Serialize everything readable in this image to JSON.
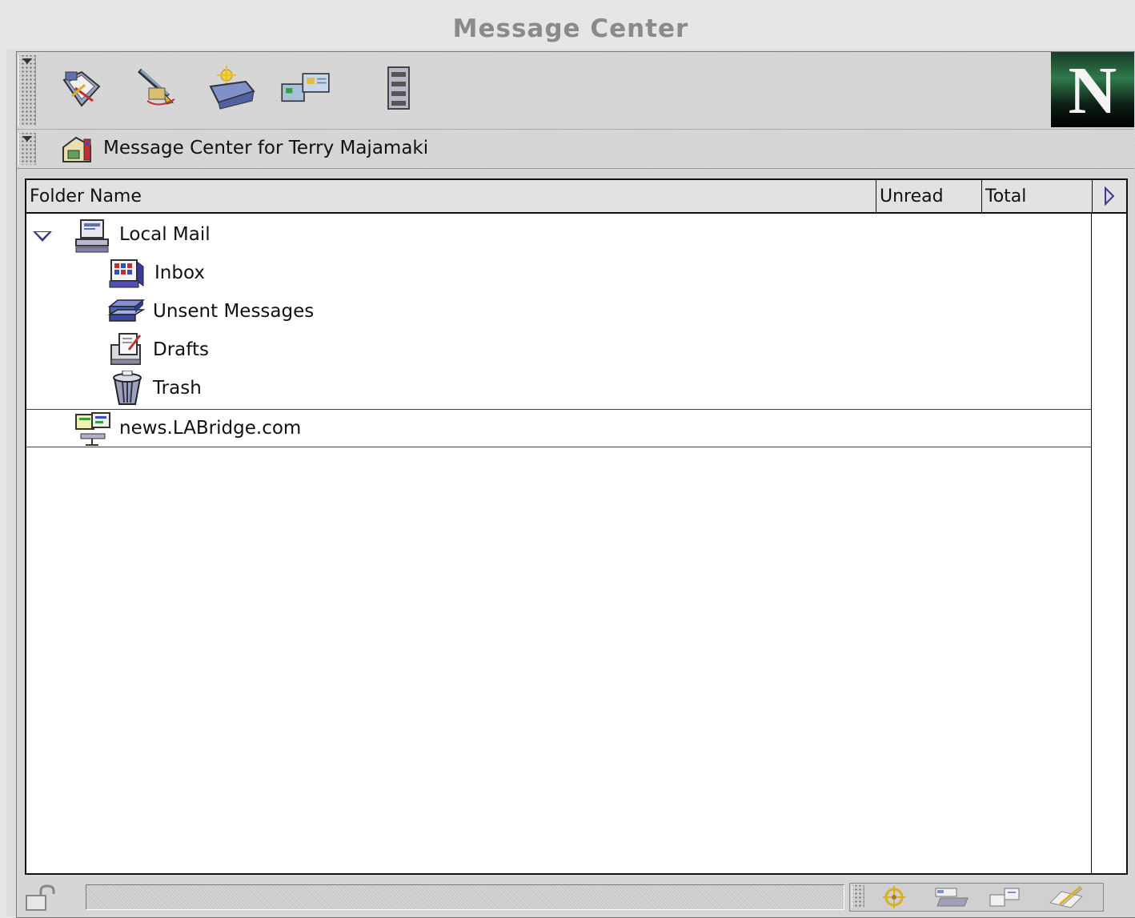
{
  "window": {
    "title": "Message Center"
  },
  "toolbar": {
    "buttons": [
      {
        "icon": "get-mail-icon"
      },
      {
        "icon": "compose-icon"
      },
      {
        "icon": "new-folder-icon"
      },
      {
        "icon": "address-book-icon"
      },
      {
        "icon": "stop-icon"
      }
    ],
    "logo_letter": "N"
  },
  "location": {
    "label": "Message Center for Terry Majamaki"
  },
  "table": {
    "columns": [
      {
        "label": "Folder Name"
      },
      {
        "label": "Unread"
      },
      {
        "label": "Total"
      }
    ],
    "rows": [
      {
        "label": "Local Mail",
        "icon": "computer-icon",
        "expanded": true
      },
      {
        "label": "Inbox",
        "icon": "inbox-icon"
      },
      {
        "label": "Unsent Messages",
        "icon": "unsent-messages-icon"
      },
      {
        "label": "Drafts",
        "icon": "drafts-icon"
      },
      {
        "label": "Trash",
        "icon": "trash-icon"
      },
      {
        "label": "news.LABridge.com",
        "icon": "news-server-icon"
      }
    ]
  },
  "statusbar": {
    "icons": [
      "lock-icon",
      "navigator-icon",
      "mail-icon",
      "newsgroups-icon",
      "composer-icon"
    ]
  }
}
